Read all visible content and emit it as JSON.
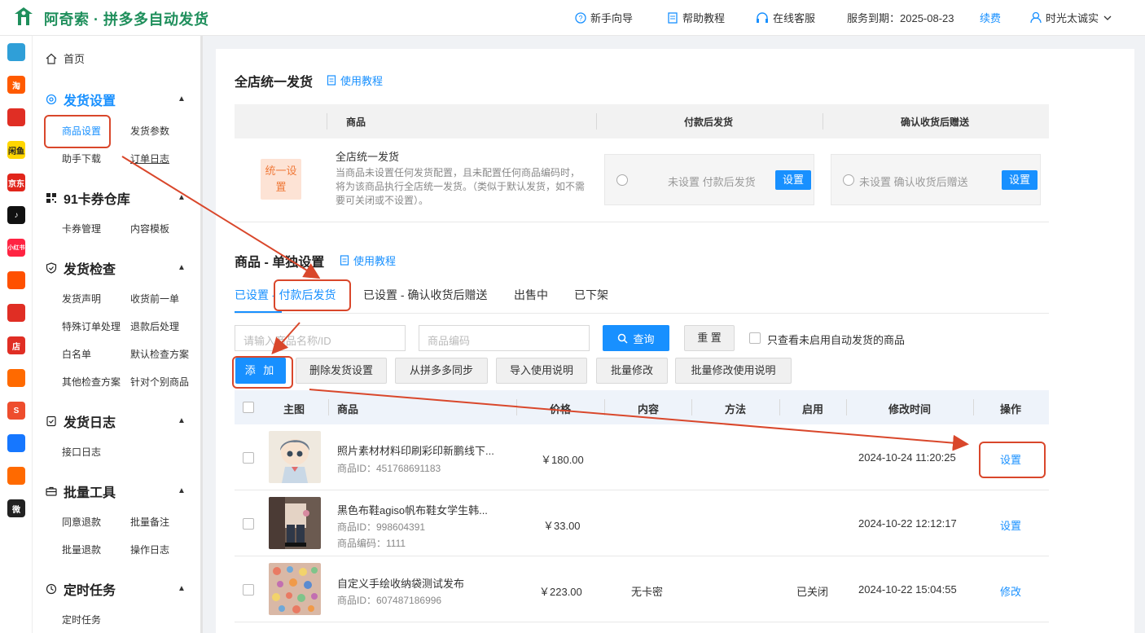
{
  "header": {
    "brand": "阿奇索 · 拼多多自动发货",
    "nav": {
      "guide": "新手向导",
      "help": "帮助教程",
      "service": "在线客服",
      "expiry": "服务到期：2025-08-23",
      "renew": "续费",
      "user": "时光太诚实"
    }
  },
  "apps": [
    {
      "icon": "grid-app-icon",
      "label": "",
      "color": "#2f9fd8"
    },
    {
      "icon": "taobao-icon",
      "label": "淘",
      "color": "#ff5a00"
    },
    {
      "icon": "pinduoduo-icon",
      "label": "",
      "color": "#e02e24"
    },
    {
      "icon": "fliggy-icon",
      "label": "闲鱼",
      "color": "#ffd600"
    },
    {
      "icon": "jd-icon",
      "label": "京东",
      "color": "#e1251b"
    },
    {
      "icon": "douyin-icon",
      "label": "♪",
      "color": "#111111"
    },
    {
      "icon": "xiaohongshu-icon",
      "label": "小红书",
      "color": "#ff2442"
    },
    {
      "icon": "kuaishou-icon",
      "label": "",
      "color": "#ff5000"
    },
    {
      "icon": "like-icon",
      "label": "",
      "color": "#e02e24"
    },
    {
      "icon": "shop-icon",
      "label": "店",
      "color": "#e02e24"
    },
    {
      "icon": "bag-icon",
      "label": "",
      "color": "#ff6a00"
    },
    {
      "icon": "shopee-icon",
      "label": "S",
      "color": "#ee4d2d"
    },
    {
      "icon": "link-icon",
      "label": "",
      "color": "#1677ff"
    },
    {
      "icon": "gift-icon",
      "label": "",
      "color": "#ff6a00"
    },
    {
      "icon": "weidian-icon",
      "label": "微",
      "color": "#222222"
    }
  ],
  "sidebar": {
    "home": "首页",
    "groups": [
      {
        "title": "发货设置",
        "items": [
          "商品设置",
          "发货参数",
          "助手下载",
          "订单日志"
        ]
      },
      {
        "title": "91卡券仓库",
        "items": [
          "卡券管理",
          "内容模板"
        ]
      },
      {
        "title": "发货检查",
        "items": [
          "发货声明",
          "收货前一单",
          "特殊订单处理",
          "退款后处理",
          "白名单",
          "默认检查方案",
          "其他检查方案",
          "针对个别商品"
        ]
      },
      {
        "title": "发货日志",
        "items": [
          "接口日志"
        ]
      },
      {
        "title": "批量工具",
        "items": [
          "同意退款",
          "批量备注",
          "批量退款",
          "操作日志"
        ]
      },
      {
        "title": "定时任务",
        "items": [
          "定时任务"
        ]
      }
    ]
  },
  "global": {
    "title": "全店统一发货",
    "tutorial": "使用教程",
    "headers": [
      "商品",
      "付款后发货",
      "确认收货后赠送"
    ],
    "badge": "统一设置",
    "item_title": "全店统一发货",
    "item_desc": "当商品未设置任何发货配置，且未配置任何商品编码时，将为该商品执行全店统一发货。（类似于默认发货，如不需要可关闭或不设置）。",
    "pay_label": "未设置 付款后发货",
    "confirm_label": "未设置 确认收货后赠送",
    "set_btn": "设置"
  },
  "single": {
    "title": "商品 - 单独设置",
    "tutorial": "使用教程",
    "tabs": [
      "已设置 - 付款后发货",
      "已设置 - 确认收货后赠送",
      "出售中",
      "已下架"
    ],
    "search_placeholder": "请输入商品名称/ID",
    "code_placeholder": "商品编码",
    "query": "查询",
    "reset": "重 置",
    "only_disabled": "只查看未启用自动发货的商品",
    "actions": {
      "add": "添 加",
      "delete": "删除发货设置",
      "sync": "从拼多多同步",
      "import": "导入使用说明",
      "batch_edit": "批量修改",
      "batch_edit_desc": "批量修改使用说明"
    },
    "columns": [
      "主图",
      "商品",
      "价格",
      "内容",
      "方法",
      "启用",
      "修改时间",
      "操作"
    ],
    "rows": [
      {
        "name": "照片素材材料印刷彩印新鹏线下...",
        "id": "商品ID：451768691183",
        "code": "",
        "price": "￥180.00",
        "content": "",
        "method": "",
        "enabled": "",
        "time": "2024-10-24 11:20:25",
        "op": "设置"
      },
      {
        "name": "黑色布鞋agiso帆布鞋女学生韩...",
        "id": "商品ID：998604391",
        "code": "商品编码：1111",
        "price": "￥33.00",
        "content": "",
        "method": "",
        "enabled": "",
        "time": "2024-10-22 12:12:17",
        "op": "设置"
      },
      {
        "name": "自定义手绘收纳袋测试发布",
        "id": "商品ID：607487186996",
        "code": "",
        "price": "￥223.00",
        "content": "无卡密",
        "method": "",
        "enabled": "已关闭",
        "time": "2024-10-22 15:04:55",
        "op": "修改"
      }
    ]
  },
  "colors": {
    "accent": "#1890ff",
    "brand": "#1f8f5c",
    "annotation": "#d9472b"
  }
}
